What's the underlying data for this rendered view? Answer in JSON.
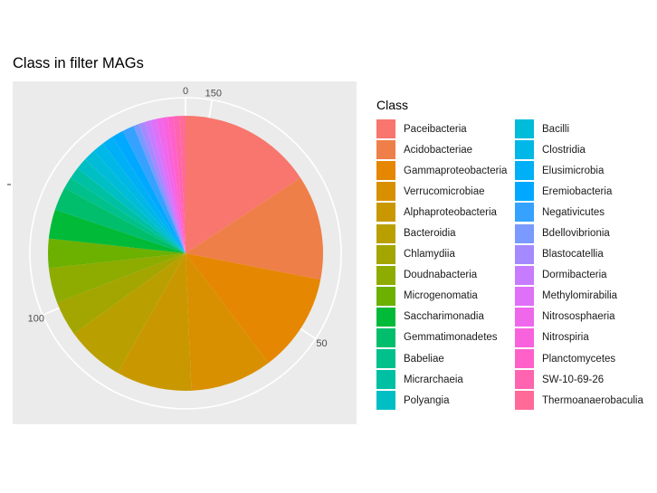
{
  "chart_data": {
    "type": "pie",
    "title": "Class in filter MAGs",
    "legend_title": "Class",
    "legend_position": "right",
    "ticks": [
      "0",
      "50",
      "100",
      "150"
    ],
    "tick_values": [
      0,
      50,
      100,
      150
    ],
    "slices": [
      {
        "label": "Paceibacteria",
        "value": 23,
        "color": "#F8766D"
      },
      {
        "label": "Acidobacteriae",
        "value": 18,
        "color": "#EF7F48"
      },
      {
        "label": "Gammaproteobacteria",
        "value": 17,
        "color": "#E58700"
      },
      {
        "label": "Verrucomicrobiae",
        "value": 14,
        "color": "#D89000"
      },
      {
        "label": "Alphaproteobacteria",
        "value": 13,
        "color": "#C99800"
      },
      {
        "label": "Bacteroidia",
        "value": 10,
        "color": "#B9A000"
      },
      {
        "label": "Chlamydiia",
        "value": 6,
        "color": "#A3A500"
      },
      {
        "label": "Doudnabacteria",
        "value": 6,
        "color": "#8EAB00"
      },
      {
        "label": "Microgenomatia",
        "value": 5,
        "color": "#6CB000"
      },
      {
        "label": "Saccharimonadia",
        "value": 5,
        "color": "#00BA38"
      },
      {
        "label": "Gemmatimonadetes",
        "value": 4,
        "color": "#00BE6C"
      },
      {
        "label": "Babeliae",
        "value": 2,
        "color": "#00C08B"
      },
      {
        "label": "Micrarchaeia",
        "value": 2,
        "color": "#00C0A4"
      },
      {
        "label": "Polyangia",
        "value": 2,
        "color": "#00BFC4"
      },
      {
        "label": "Bacilli",
        "value": 2,
        "color": "#00BCD8"
      },
      {
        "label": "Clostridia",
        "value": 2,
        "color": "#00B8E7"
      },
      {
        "label": "Elusimicrobia",
        "value": 2,
        "color": "#00B0F6"
      },
      {
        "label": "Eremiobacteria",
        "value": 2,
        "color": "#00A9FF"
      },
      {
        "label": "Negativicutes",
        "value": 2,
        "color": "#35A2FF"
      },
      {
        "label": "Bdellovibrionia",
        "value": 1,
        "color": "#7A9AFF"
      },
      {
        "label": "Blastocatellia",
        "value": 1,
        "color": "#A58AFF"
      },
      {
        "label": "Dormibacteria",
        "value": 1,
        "color": "#C77CFF"
      },
      {
        "label": "Methylomirabilia",
        "value": 1,
        "color": "#DF70F8"
      },
      {
        "label": "Nitrososphaeria",
        "value": 1,
        "color": "#EF67EB"
      },
      {
        "label": "Nitrospiria",
        "value": 1,
        "color": "#F962DD"
      },
      {
        "label": "Planctomycetes",
        "value": 1,
        "color": "#FF61C9"
      },
      {
        "label": "SW-10-69-26",
        "value": 1,
        "color": "#FF64B0"
      },
      {
        "label": "Thermoanaerobaculia",
        "value": 1,
        "color": "#FF6A98"
      }
    ]
  }
}
